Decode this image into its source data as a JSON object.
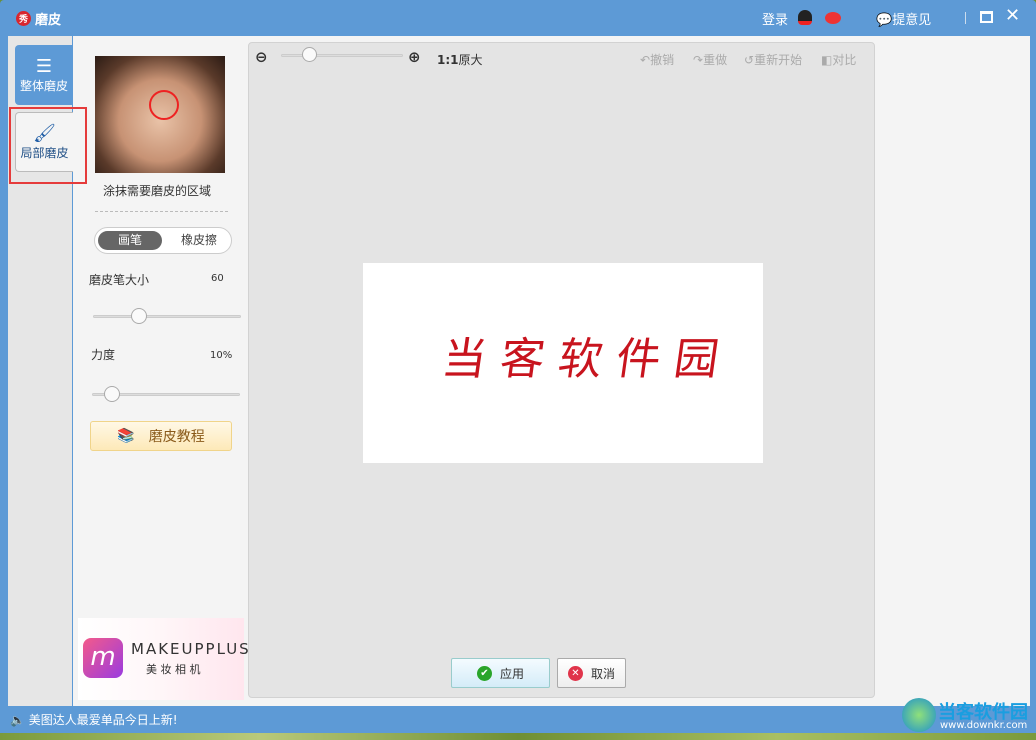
{
  "window": {
    "title": "磨皮",
    "logo": "秀",
    "login": "登录",
    "feedback": "提意见"
  },
  "tabs": [
    {
      "label": "整体磨皮",
      "icon": "sliders-icon"
    },
    {
      "label": "局部磨皮",
      "icon": "brush-icon"
    }
  ],
  "panel": {
    "hint": "涂抹需要磨皮的区域",
    "mode_brush": "画笔",
    "mode_eraser": "橡皮擦",
    "brush_size_label": "磨皮笔大小",
    "brush_size_value": "60",
    "brush_size_fraction": 0.3,
    "strength_label": "力度",
    "strength_value": "10%",
    "strength_fraction": 0.1,
    "tutorial": "磨皮教程"
  },
  "ad": {
    "brand": "MAKEUPPLUS",
    "sub": "美 妆 相 机"
  },
  "toolbar": {
    "zoom_fraction": 0.2,
    "actual_size_bold": "1:1",
    "actual_size": "原大",
    "undo": "撤销",
    "redo": "重做",
    "restart": "重新开始",
    "compare": "对比"
  },
  "canvas": {
    "text": "当客软件园",
    "color": "#c8141e"
  },
  "actions": {
    "apply": "应用",
    "cancel": "取消"
  },
  "status": {
    "message": "美图达人最爱单品今日上新!"
  },
  "watermark": {
    "name": "当客软件园",
    "url": "www.downkr.com"
  }
}
